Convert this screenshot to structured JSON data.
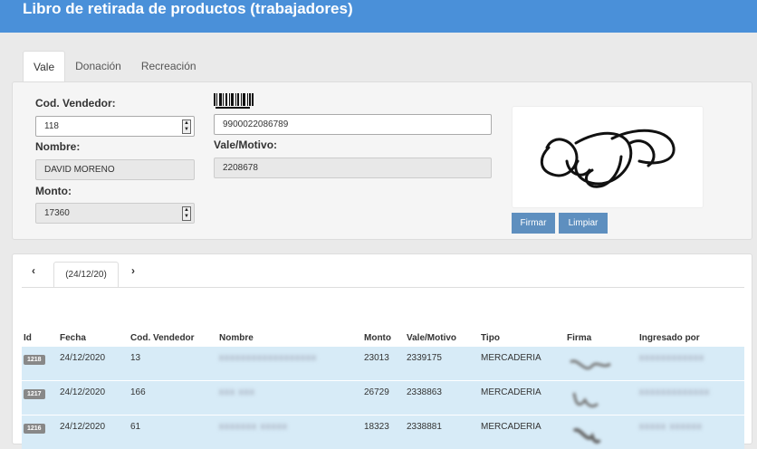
{
  "header": {
    "title": "Libro de retirada de productos (trabajadores)"
  },
  "tabs": [
    "Vale",
    "Donación",
    "Recreación"
  ],
  "form": {
    "vendedor_label": "Cod. Vendedor:",
    "vendedor_value": "118",
    "nombre_label": "Nombre:",
    "nombre_value": "DAVID MORENO",
    "monto_label": "Monto:",
    "monto_value": "17360",
    "barcode_value": "9900022086789",
    "vale_label": "Vale/Motivo:",
    "vale_value": "2208678",
    "firmar_label": "Firmar",
    "limpiar_label": "Limpiar"
  },
  "date_nav": {
    "prev": "‹",
    "current": "(24/12/20)",
    "next": "›"
  },
  "table": {
    "headers": [
      "Id",
      "Fecha",
      "Cod. Vendedor",
      "Nombre",
      "Monto",
      "Vale/Motivo",
      "Tipo",
      "Firma",
      "Ingresado por"
    ],
    "rows": [
      {
        "id": "1218",
        "fecha": "24/12/2020",
        "cod": "13",
        "nombre": "xxxxxxxxxxxxxxxxxx",
        "monto": "23013",
        "vale": "2339175",
        "tipo": "MERCADERIA",
        "ingresado": "xxxxxxxxxxxx"
      },
      {
        "id": "1217",
        "fecha": "24/12/2020",
        "cod": "166",
        "nombre": "xxx xxx",
        "monto": "26729",
        "vale": "2338863",
        "tipo": "MERCADERIA",
        "ingresado": "xxxxxxxxxxxxx"
      },
      {
        "id": "1216",
        "fecha": "24/12/2020",
        "cod": "61",
        "nombre": "xxxxxxx xxxxx",
        "monto": "18323",
        "vale": "2338881",
        "tipo": "MERCADERIA",
        "ingresado": "xxxxx xxxxxx"
      }
    ]
  },
  "colors": {
    "header": "#4a90d9",
    "button": "#5e8fbf",
    "row": "#d7ebf7"
  }
}
